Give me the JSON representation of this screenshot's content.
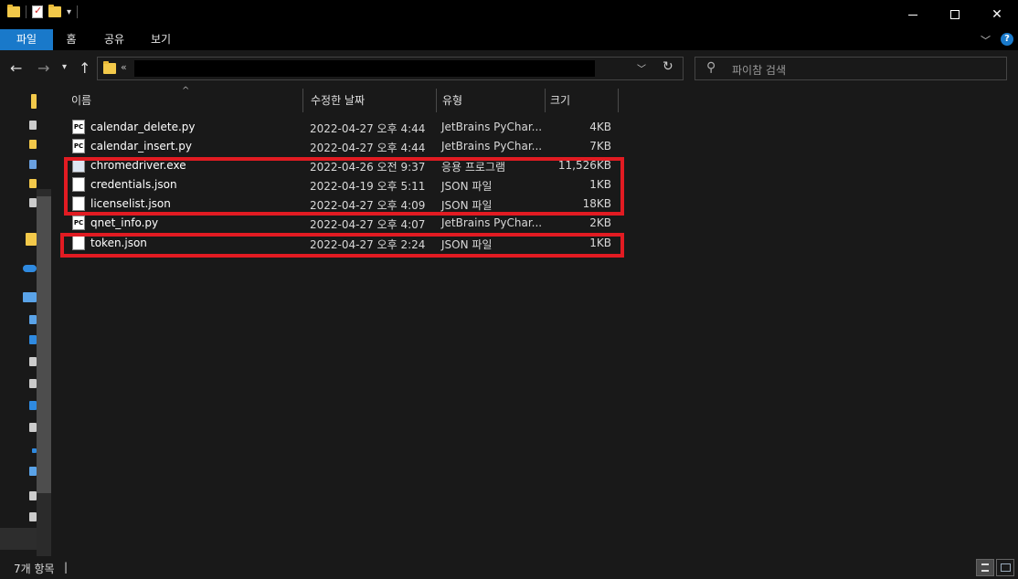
{
  "ribbon": {
    "tabs": [
      "파일",
      "홈",
      "공유",
      "보기"
    ]
  },
  "search": {
    "placeholder": "파이참 검색"
  },
  "address": {
    "chevron": "«"
  },
  "columns": {
    "name": "이름",
    "date": "수정한 날짜",
    "type": "유형",
    "size": "크기"
  },
  "files": [
    {
      "name": "calendar_delete.py",
      "date": "2022-04-27 오후 4:44",
      "type": "JetBrains PyChar...",
      "size": "4KB",
      "icon": "pycharm-file-icon"
    },
    {
      "name": "calendar_insert.py",
      "date": "2022-04-27 오후 4:44",
      "type": "JetBrains PyChar...",
      "size": "7KB",
      "icon": "pycharm-file-icon"
    },
    {
      "name": "chromedriver.exe",
      "date": "2022-04-26 오전 9:37",
      "type": "응용 프로그램",
      "size": "11,526KB",
      "icon": "application-icon"
    },
    {
      "name": "credentials.json",
      "date": "2022-04-19 오후 5:11",
      "type": "JSON 파일",
      "size": "1KB",
      "icon": "json-file-icon"
    },
    {
      "name": "licenselist.json",
      "date": "2022-04-27 오후 4:09",
      "type": "JSON 파일",
      "size": "18KB",
      "icon": "json-file-icon"
    },
    {
      "name": "qnet_info.py",
      "date": "2022-04-27 오후 4:07",
      "type": "JetBrains PyChar...",
      "size": "2KB",
      "icon": "pycharm-file-icon"
    },
    {
      "name": "token.json",
      "date": "2022-04-27 오후 2:24",
      "type": "JSON 파일",
      "size": "1KB",
      "icon": "json-file-icon"
    }
  ],
  "status": {
    "count": "7개 항목",
    "separator": "|"
  },
  "colors": {
    "accent": "#1979ca",
    "highlight": "#e21b22",
    "background": "#191919"
  }
}
